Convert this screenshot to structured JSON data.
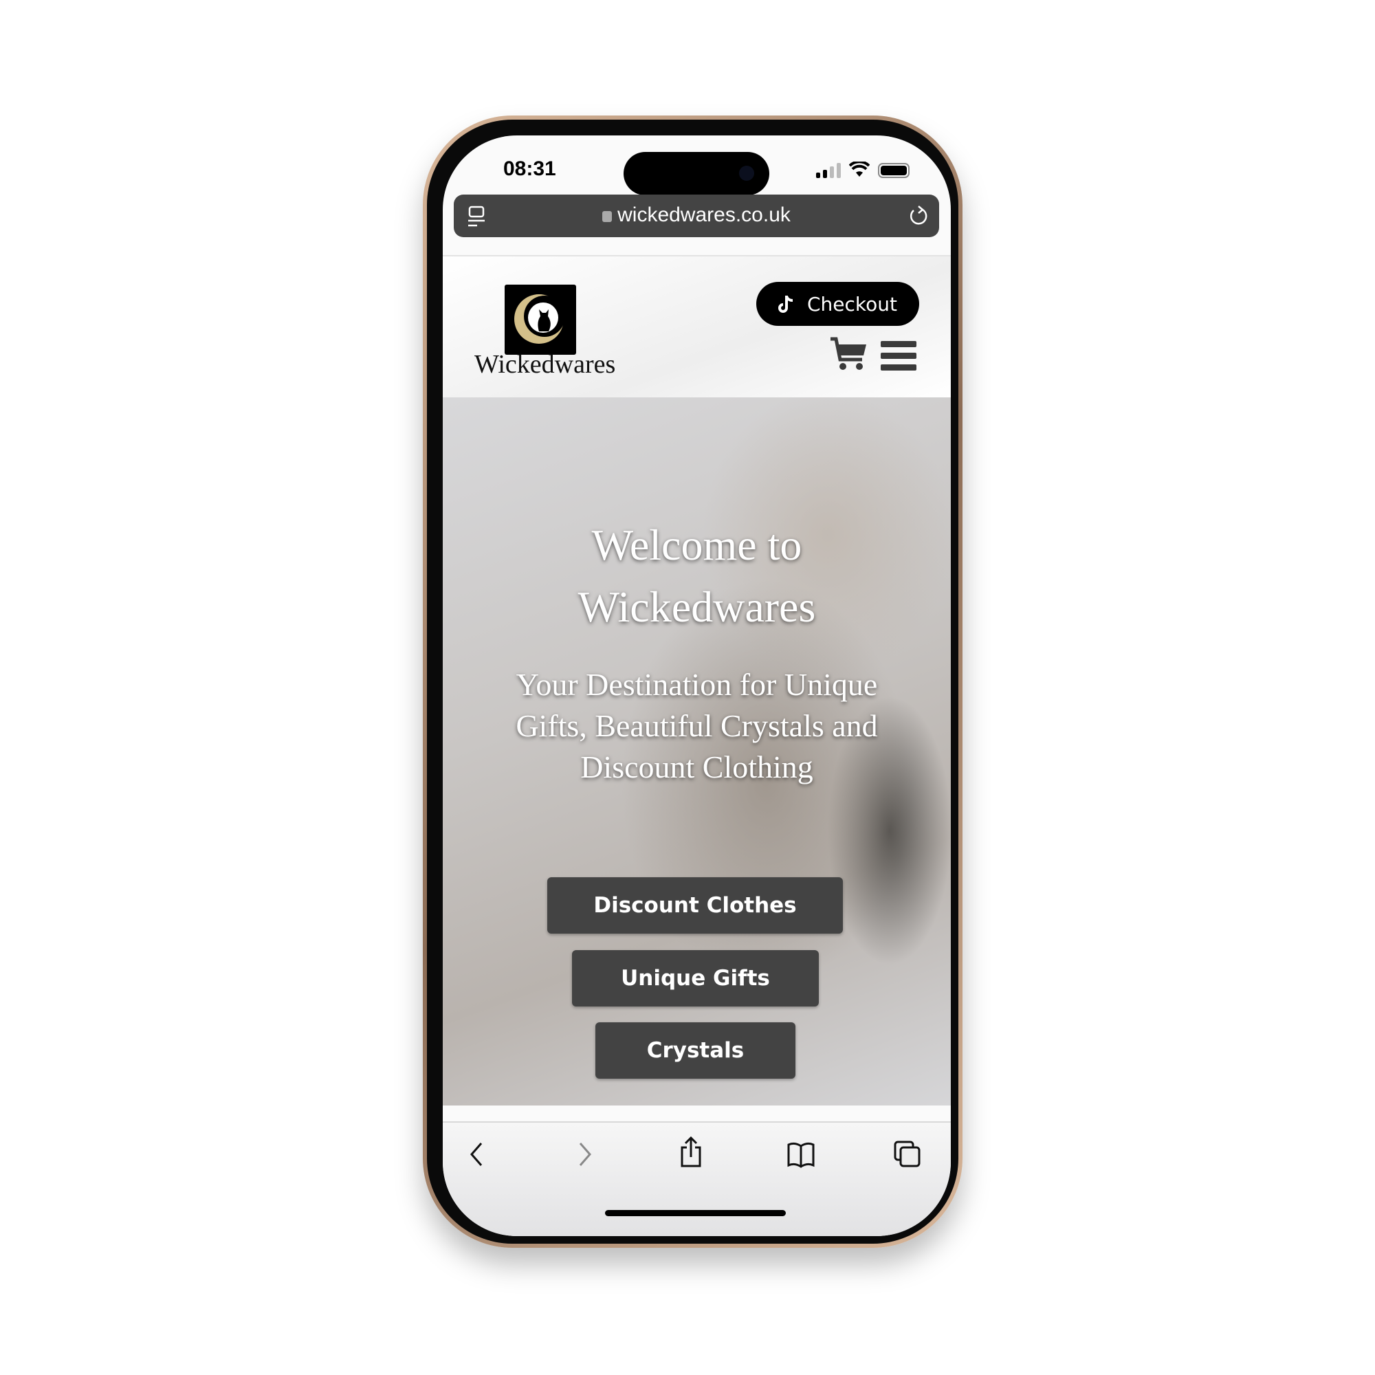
{
  "status_bar": {
    "time": "08:31"
  },
  "browser": {
    "url": "wickedwares.co.uk"
  },
  "header": {
    "brand": "Wickedwares",
    "checkout_label": "Checkout"
  },
  "hero": {
    "title_line1": "Welcome to",
    "title_line2": "Wickedwares",
    "subtitle_line1": "Your Destination for Unique",
    "subtitle_line2": "Gifts, Beautiful Crystals and",
    "subtitle_line3": "Discount Clothing",
    "buttons": [
      {
        "label": "Discount Clothes"
      },
      {
        "label": "Unique Gifts"
      },
      {
        "label": "Crystals"
      }
    ]
  },
  "colors": {
    "accent_gold": "#d4c08a",
    "button": "#434343",
    "urlbar": "#444444"
  }
}
